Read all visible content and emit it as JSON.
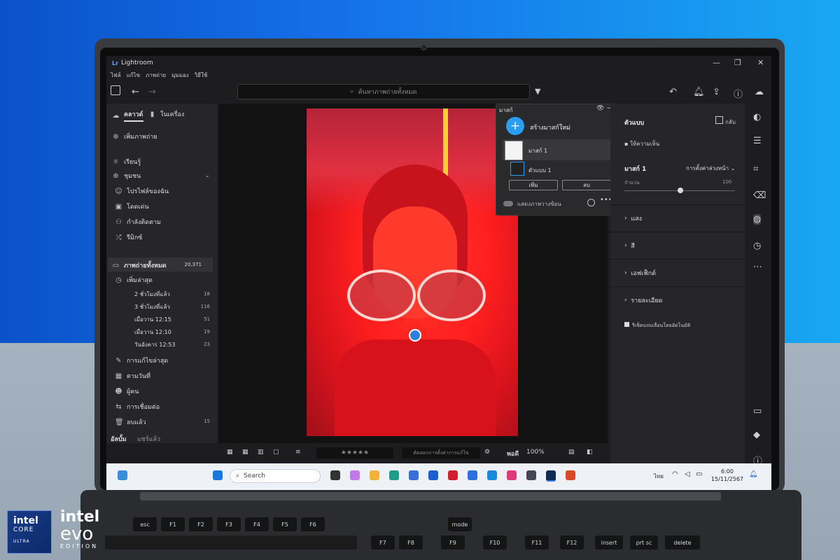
{
  "window": {
    "title": "Lightroom",
    "controls": [
      "—",
      "❐",
      "✕"
    ]
  },
  "menu": [
    "ไฟล์",
    "แก้ไข",
    "ภาพถ่าย",
    "มุมมอง",
    "วิธีใช้"
  ],
  "toolbar": {
    "search_placeholder": "ค้นหาภาพถ่ายทั้งหมด"
  },
  "left_panel": {
    "tabs": [
      "คลาวด์",
      "ในเครื่อง"
    ],
    "add_photos": "เพิ่มภาพถ่าย",
    "learn": "เรียนรู้",
    "community": "ชุมชน",
    "community_items": [
      "โปรไฟล์ของฉัน",
      "โดดเด่น",
      "กำลังติดตาม",
      "รีมิกซ์"
    ],
    "all_photos": {
      "label": "ภาพถ่ายทั้งหมด",
      "count": "20,371"
    },
    "recent": "เพิ่มล่าสุด",
    "recent_items": [
      {
        "label": "2 ชั่วโมงที่แล้ว",
        "count": "18"
      },
      {
        "label": "3 ชั่วโมงที่แล้ว",
        "count": "116"
      },
      {
        "label": "เมื่อวาน 12:15",
        "count": "51"
      },
      {
        "label": "เมื่อวาน 12:10",
        "count": "19"
      },
      {
        "label": "วันอังคาร 12:53",
        "count": "23"
      }
    ],
    "other_items": [
      "การแก้ไขล่าสุด",
      "ตามวันที่",
      "ผู้คน",
      "การเชื่อมต่อ"
    ],
    "deleted": {
      "label": "ลบแล้ว",
      "count": "15"
    },
    "albums": "อัลบั้ม",
    "shared": "แชร์แล้ว"
  },
  "masks_popup": {
    "title": "มาสก์",
    "create_new": "สร้างมาสก์ใหม่",
    "mask_name": "มาสก์ 1",
    "component": "ตัวแบบ 1",
    "add": "เพิ่ม",
    "subtract": "ลบ",
    "show_overlay": "แสดงภาพวางซ้อน"
  },
  "right_panel": {
    "header": "ตัวแบบ",
    "back": "กลับ",
    "feedback": "ให้ความเห็น",
    "mask_label": "มาสก์ 1",
    "preset": "การตั้งค่าล่วงหน้า",
    "amount_label": "จำนวน",
    "amount_value": "100",
    "sections": [
      "แสง",
      "สี",
      "เอฟเฟ็กต์",
      "รายละเอียด"
    ],
    "auto_sync": "รีเซ็ตแถบเลื่อนโดยอัตโนมัติ"
  },
  "bottom_bar": {
    "sort_placeholder": "คัดลอกการตั้งค่าการแก้ไข",
    "fit": "พอดี",
    "zoom": "100%",
    "stars": "★★★★★"
  },
  "taskbar": {
    "search": "Search",
    "lang": "ไทย",
    "time": "6:00",
    "date": "15/11/2567"
  },
  "badges": {
    "intel_core": "intel",
    "core": "CORE",
    "ultra": "ULTRA",
    "evo_intel": "intel",
    "evo": "evo",
    "edition": "EDITION"
  },
  "keyboard": [
    "esc",
    "F1",
    "F2",
    "F3",
    "F4",
    "F5",
    "F6",
    "F7",
    "F8",
    "F9",
    "F10",
    "F11",
    "F12",
    "insert",
    "prt sc",
    "delete",
    "mode"
  ]
}
